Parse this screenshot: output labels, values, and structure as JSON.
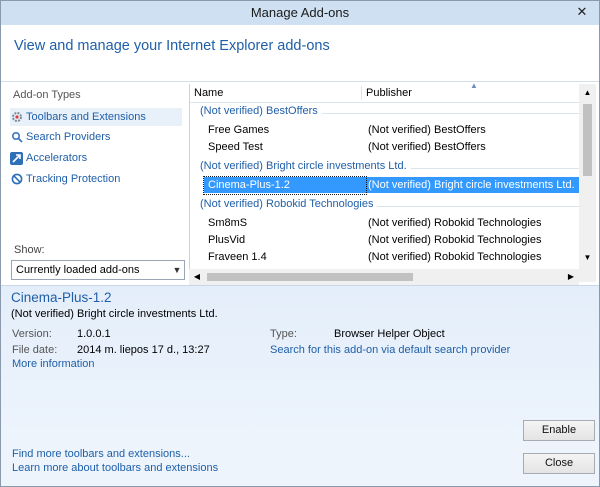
{
  "window": {
    "title": "Manage Add-ons",
    "close_glyph": "✕"
  },
  "header": {
    "heading": "View and manage your Internet Explorer add-ons"
  },
  "left_pane": {
    "title": "Add-on Types",
    "types": [
      {
        "label": "Toolbars and Extensions",
        "icon": "gear-icon"
      },
      {
        "label": "Search Providers",
        "icon": "search-icon"
      },
      {
        "label": "Accelerators",
        "icon": "accelerator-icon"
      },
      {
        "label": "Tracking Protection",
        "icon": "tracking-protection-icon"
      }
    ],
    "show_label": "Show:",
    "show_value": "Currently loaded add-ons"
  },
  "list": {
    "col_name": "Name",
    "col_publisher": "Publisher",
    "groups": [
      {
        "title": "(Not verified) BestOffers",
        "rows": [
          {
            "name": "Free Games",
            "publisher": "(Not verified) BestOffers"
          },
          {
            "name": "Speed Test",
            "publisher": "(Not verified) BestOffers"
          }
        ]
      },
      {
        "title": "(Not verified) Bright circle investments Ltd.",
        "rows": [
          {
            "name": "Cinema-Plus-1.2",
            "publisher": "(Not verified) Bright circle investments Ltd."
          }
        ]
      },
      {
        "title": "(Not verified) Robokid Technologies",
        "rows": [
          {
            "name": "Sm8mS",
            "publisher": "(Not verified) Robokid Technologies"
          },
          {
            "name": "PlusVid",
            "publisher": "(Not verified) Robokid Technologies"
          },
          {
            "name": "Fraveen 1.4",
            "publisher": "(Not verified) Robokid Technologies"
          }
        ]
      }
    ]
  },
  "details": {
    "name": "Cinema-Plus-1.2",
    "publisher": "(Not verified) Bright circle investments Ltd.",
    "version_label": "Version:",
    "version": "1.0.0.1",
    "filedate_label": "File date:",
    "filedate": "2014 m. liepos 17 d., 13:27",
    "more_info": "More information",
    "type_label": "Type:",
    "type": "Browser Helper Object",
    "search_link": "Search for this add-on via default search provider",
    "enable_button": "Enable"
  },
  "footer": {
    "find_more": "Find more toolbars and extensions...",
    "learn_more": "Learn more about toolbars and extensions",
    "close_button": "Close"
  },
  "colors": {
    "accent": "#1f5fa8",
    "selection": "#3399ff",
    "titlebar": "#cfe0f3"
  }
}
